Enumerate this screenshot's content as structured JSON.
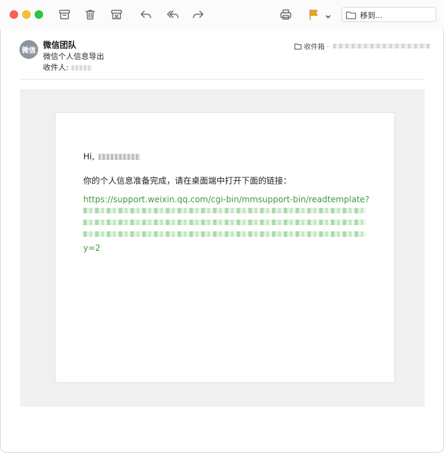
{
  "toolbar": {
    "icons": [
      "archive-icon",
      "trash-icon",
      "junk-icon",
      "reply-icon",
      "reply-all-icon",
      "forward-icon",
      "print-icon",
      "flag-icon",
      "chevron-down-icon",
      "folder-icon"
    ],
    "move_label": "移到...",
    "flag_color": "#f0a12c"
  },
  "header": {
    "avatar_text": "微信",
    "sender": "微信团队",
    "subject": "微信个人信息导出",
    "to_label": "收件人:",
    "mailbox_label": "收件箱 ·"
  },
  "body": {
    "greeting": "Hi,",
    "intro": "你的个人信息准备完成，请在桌面端中打开下面的链接：",
    "link_start": "https://support.weixin.qq.com/cgi-bin/mmsupport-bin/readtemplate?",
    "link_end": "y=2",
    "link_color": "#3d9b3d"
  }
}
